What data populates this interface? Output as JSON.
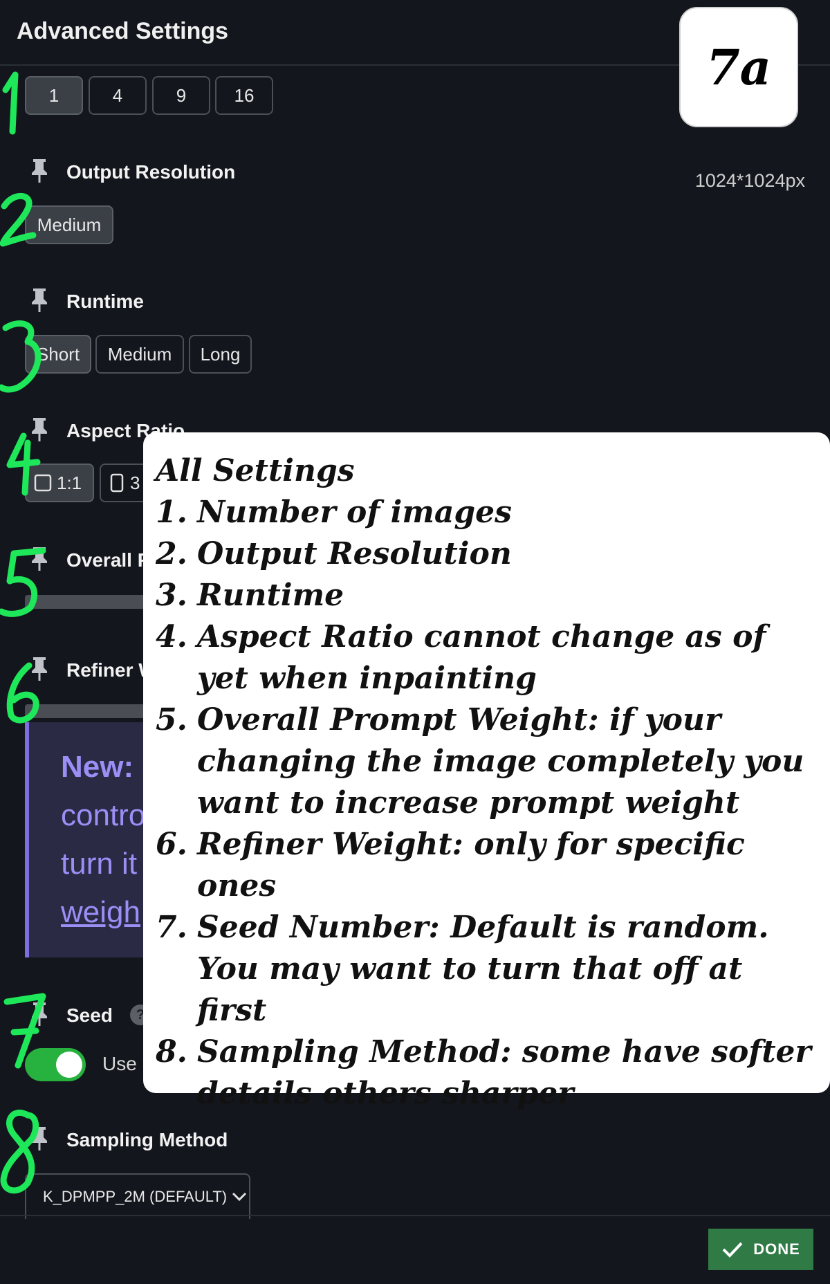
{
  "header": {
    "title": "Advanced Settings",
    "badge": "7a"
  },
  "image_count": {
    "options": [
      "1",
      "4",
      "9",
      "16"
    ],
    "selected": "1"
  },
  "output_resolution": {
    "label": "Output Resolution",
    "value": "1024*1024px",
    "options": [
      "Medium"
    ],
    "selected": "Medium"
  },
  "runtime": {
    "label": "Runtime",
    "options": [
      "Short",
      "Medium",
      "Long"
    ],
    "selected": "Short"
  },
  "aspect_ratio": {
    "label": "Aspect Ratio",
    "options": [
      "1:1",
      "3"
    ],
    "selected": "1:1"
  },
  "overall_prompt_weight": {
    "label": "Overall P"
  },
  "refiner_weight": {
    "label": "Refiner W"
  },
  "info_box": {
    "line1_bold": "New: S",
    "line2": "contro",
    "line3": "turn it",
    "line4_link": "weigh"
  },
  "seed": {
    "label": "Seed",
    "help": "?",
    "toggle_label": "Use",
    "toggle_on": true
  },
  "sampling_method": {
    "label": "Sampling Method",
    "selected": "K_DPMPP_2M (DEFAULT)"
  },
  "footer": {
    "done_label": "DONE"
  },
  "colors": {
    "background": "#13161c",
    "toggle_on": "#27b13f",
    "done_button": "#2f7a45",
    "info_accent": "#7e6fe0",
    "handwriting": "#1ee85a"
  },
  "note": {
    "title": "All Settings",
    "items": [
      {
        "num": "1.",
        "text": "Number of images"
      },
      {
        "num": "2.",
        "text": "Output Resolution"
      },
      {
        "num": "3.",
        "text": "Runtime"
      },
      {
        "num": "4.",
        "text": "Aspect Ratio cannot change as of yet when inpainting"
      },
      {
        "num": "5.",
        "text": "Overall Prompt Weight:  if your changing the image completely you want to increase prompt weight"
      },
      {
        "num": "6.",
        "text": "Refiner Weight:  only for specific ones"
      },
      {
        "num": "7.",
        "text": "Seed Number:  Default is random.  You may want to turn that off at first"
      },
      {
        "num": "8.",
        "text": "Sampling Method: some have softer details others sharper"
      }
    ]
  }
}
